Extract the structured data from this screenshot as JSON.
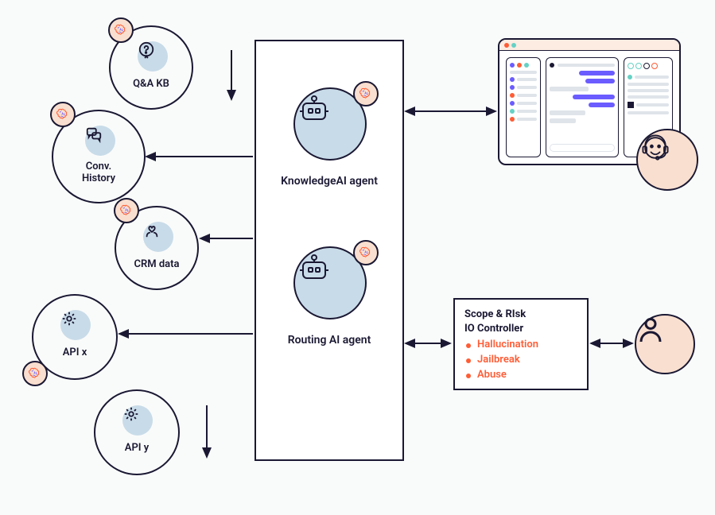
{
  "nodes": {
    "qa_kb": "Q&A KB",
    "conv_history": "Conv.\nHistory",
    "crm_data": "CRM data",
    "api_x": "API x",
    "api_y": "API y"
  },
  "agents": {
    "knowledge": "KnowledgeAI agent",
    "routing": "Routing AI agent"
  },
  "risk": {
    "title": "Scope & RIsk\nIO Controller",
    "items": [
      "Hallucination",
      "Jailbreak",
      "Abuse"
    ]
  },
  "colors": {
    "accent": "#ff5c35",
    "stroke": "#1a1833",
    "nodefill": "#c8dbe8",
    "badgefill": "#f9dfcf"
  }
}
